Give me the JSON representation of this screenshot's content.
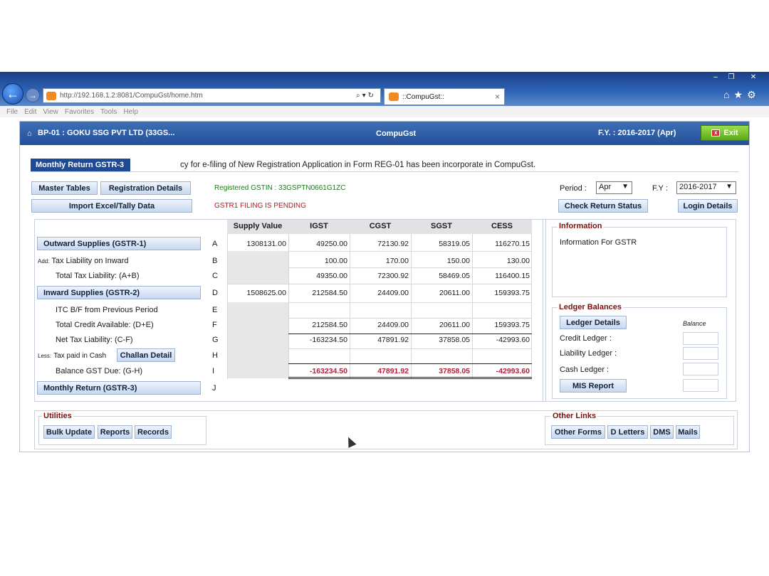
{
  "browser": {
    "url": "http://192.168.1.2:8081/CompuGst/home.htm",
    "tab_title": "::CompuGst::",
    "tab_close": "×",
    "menu": [
      "File",
      "Edit",
      "View",
      "Favorites",
      "Tools",
      "Help"
    ],
    "window_controls": {
      "minimize": "–",
      "maximize": "❐",
      "close": "✕"
    },
    "icons": [
      "home-icon",
      "star-icon",
      "gear-icon"
    ]
  },
  "header": {
    "company": "BP-01 : GOKU SSG PVT LTD (33GS...",
    "app_name": "CompuGst",
    "fy": "F.Y. : 2016-2017 (Apr)",
    "exit_label": "Exit"
  },
  "tab": {
    "label": "Monthly Return GSTR-3"
  },
  "ticker": "cy for e-filing of New Registration Application in Form REG-01 has been incorporate in CompuGst.",
  "toolbar": {
    "master_tables": "Master Tables",
    "registration_details": "Registration Details",
    "import_excel": "Import Excel/Tally Data",
    "check_return_status": "Check Return Status",
    "login_details": "Login Details"
  },
  "status": {
    "gstin": "Registered GSTIN : 33GSPTN0661G1ZC",
    "pending": "GSTR1 FILING IS PENDING"
  },
  "period": {
    "label": "Period :",
    "value": "Apr",
    "fy_label": "F.Y :",
    "fy_value": "2016-2017"
  },
  "table": {
    "headers": [
      "Supply Value",
      "IGST",
      "CGST",
      "SGST",
      "CESS"
    ],
    "rows": [
      {
        "label": "Outward Supplies (GSTR-1)",
        "letter": "A",
        "supply": "1308131.00",
        "igst": "49250.00",
        "cgst": "72130.92",
        "sgst": "58319.05",
        "cess": "116270.15"
      },
      {
        "prefix": "Add:",
        "label": "Tax Liability on Inward",
        "letter": "B",
        "supply": "",
        "igst": "100.00",
        "cgst": "170.00",
        "sgst": "150.00",
        "cess": "130.00"
      },
      {
        "label": "Total Tax Liability: (A+B)",
        "letter": "C",
        "supply": "",
        "igst": "49350.00",
        "cgst": "72300.92",
        "sgst": "58469.05",
        "cess": "116400.15"
      },
      {
        "label": "Inward Supplies (GSTR-2)",
        "letter": "D",
        "supply": "1508625.00",
        "igst": "212584.50",
        "cgst": "24409.00",
        "sgst": "20611.00",
        "cess": "159393.75"
      },
      {
        "label": "ITC B/F from Previous Period",
        "letter": "E",
        "supply": "",
        "igst": "",
        "cgst": "",
        "sgst": "",
        "cess": ""
      },
      {
        "label": "Total Credit Available: (D+E)",
        "letter": "F",
        "supply": "",
        "igst": "212584.50",
        "cgst": "24409.00",
        "sgst": "20611.00",
        "cess": "159393.75"
      },
      {
        "label": "Net Tax Liability: (C-F)",
        "letter": "G",
        "supply": "",
        "igst": "-163234.50",
        "cgst": "47891.92",
        "sgst": "37858.05",
        "cess": "-42993.60"
      },
      {
        "prefix": "Less:",
        "label": "Tax paid in Cash",
        "button": "Challan Detail",
        "letter": "H",
        "supply": "",
        "igst": "",
        "cgst": "",
        "sgst": "",
        "cess": ""
      },
      {
        "label": "Balance GST Due: (G-H)",
        "letter": "I",
        "supply": "",
        "igst": "-163234.50",
        "cgst": "47891.92",
        "sgst": "37858.05",
        "cess": "-42993.60"
      },
      {
        "label": "Monthly Return (GSTR-3)",
        "letter": "J"
      }
    ]
  },
  "information": {
    "legend": "Information",
    "text": "Information For GSTR"
  },
  "ledger": {
    "legend": "Ledger Balances",
    "details_button": "Ledger Details",
    "balance_header": "Balance",
    "credit": "Credit Ledger :",
    "liability": "Liability Ledger :",
    "cash": "Cash Ledger :",
    "mis_button": "MIS Report"
  },
  "utilities": {
    "legend": "Utilities",
    "buttons": [
      "Bulk Update",
      "Reports",
      "Records"
    ]
  },
  "other_links": {
    "legend": "Other Links",
    "buttons": [
      "Other Forms",
      "D Letters",
      "DMS",
      "Mails"
    ]
  }
}
